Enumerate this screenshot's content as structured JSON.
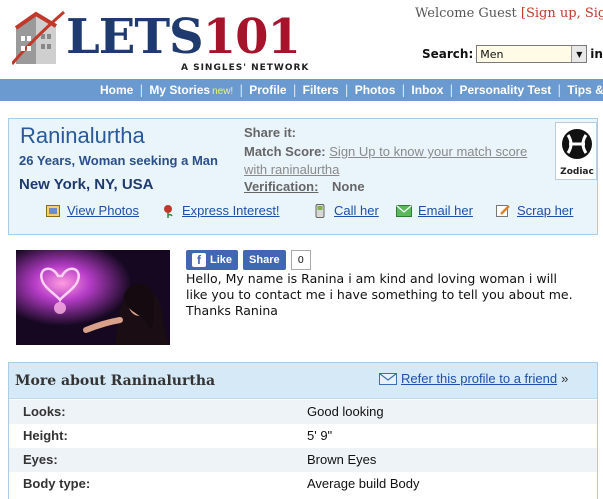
{
  "header": {
    "logo_main": "LETS",
    "logo_num": "101",
    "logo_tagline": "A SINGLES' NETWORK",
    "welcome_text": "Welcome Guest",
    "welcome_links": "[Sign up, Sign",
    "search_label": "Search:",
    "search_value": "Men",
    "search_suffix": "in Zi"
  },
  "nav": {
    "items": [
      "Home",
      "My Stories",
      "Profile",
      "Filters",
      "Photos",
      "Inbox",
      "Personality Test",
      "Tips & A"
    ],
    "new_badge": "new!"
  },
  "profile": {
    "name": "Raninalurtha",
    "subtitle": "26 Years, Woman seeking a Man",
    "location": "New York, NY, USA",
    "share_label": "Share it:",
    "match_label": "Match Score:",
    "match_link": "Sign Up to know your match score with raninalurtha",
    "verification_label": "Verification:",
    "verification_value": "None",
    "zodiac_label": "Zodiac",
    "actions": {
      "view_photos": "View Photos",
      "express_interest": "Express Interest!",
      "call_her": "Call her",
      "email_her": "Email her",
      "scrap_her": "Scrap her"
    }
  },
  "social": {
    "like": "Like",
    "share": "Share",
    "count": "0"
  },
  "about": {
    "text": "Hello, My name is Ranina i am kind and loving woman i will like you to contact me i have something to tell you about me. Thanks Ranina"
  },
  "more": {
    "title": "More about Raninalurtha",
    "refer_link": "Refer this profile to a friend",
    "refer_arrow": "»",
    "rows": [
      {
        "key": "Looks:",
        "value": "Good looking"
      },
      {
        "key": "Height:",
        "value": "5' 9\""
      },
      {
        "key": "Eyes:",
        "value": "Brown Eyes"
      },
      {
        "key": "Body type:",
        "value": "Average build Body"
      }
    ]
  },
  "colors": {
    "nav_bg": "#6b9ad0",
    "logo_blue": "#1f3a6e",
    "logo_red": "#a5142a",
    "link_blue": "#1f4fa8",
    "box_bg": "#eaf4fb",
    "facebook": "#4267b2"
  }
}
